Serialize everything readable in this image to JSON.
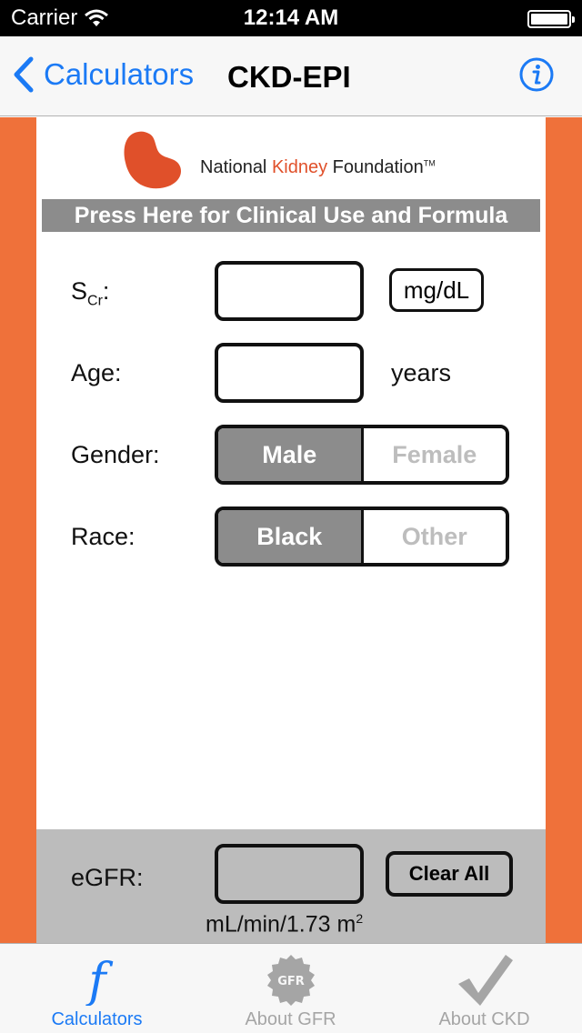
{
  "status_bar": {
    "carrier": "Carrier",
    "time": "12:14 AM"
  },
  "nav": {
    "back_label": "Calculators",
    "title": "CKD-EPI"
  },
  "org": {
    "name_part1": "National ",
    "name_part2": "Kidney",
    "name_part3": " Foundation",
    "tm": "TM"
  },
  "clinical_button": "Press Here for Clinical Use and Formula",
  "form": {
    "scr_label_main": "S",
    "scr_label_sub": "Cr",
    "scr_label_colon": ":",
    "scr_value": "",
    "scr_unit": "mg/dL",
    "age_label": "Age:",
    "age_value": "",
    "age_unit": "years",
    "gender_label": "Gender:",
    "gender_options": [
      "Male",
      "Female"
    ],
    "gender_selected": "Male",
    "race_label": "Race:",
    "race_options": [
      "Black",
      "Other"
    ],
    "race_selected": "Black"
  },
  "result": {
    "label": "eGFR:",
    "value": "",
    "clear_label": "Clear All",
    "unit_main": "mL/min/1.73 m",
    "unit_sup": "2"
  },
  "tabs": [
    {
      "label": "Calculators",
      "active": true
    },
    {
      "label": "About GFR",
      "active": false
    },
    {
      "label": "About CKD",
      "active": false
    }
  ],
  "colors": {
    "accent": "#1b7af5",
    "brand_orange": "#ef713a",
    "kidney_red": "#e0502a",
    "selected_gray": "#8c8c8c"
  }
}
